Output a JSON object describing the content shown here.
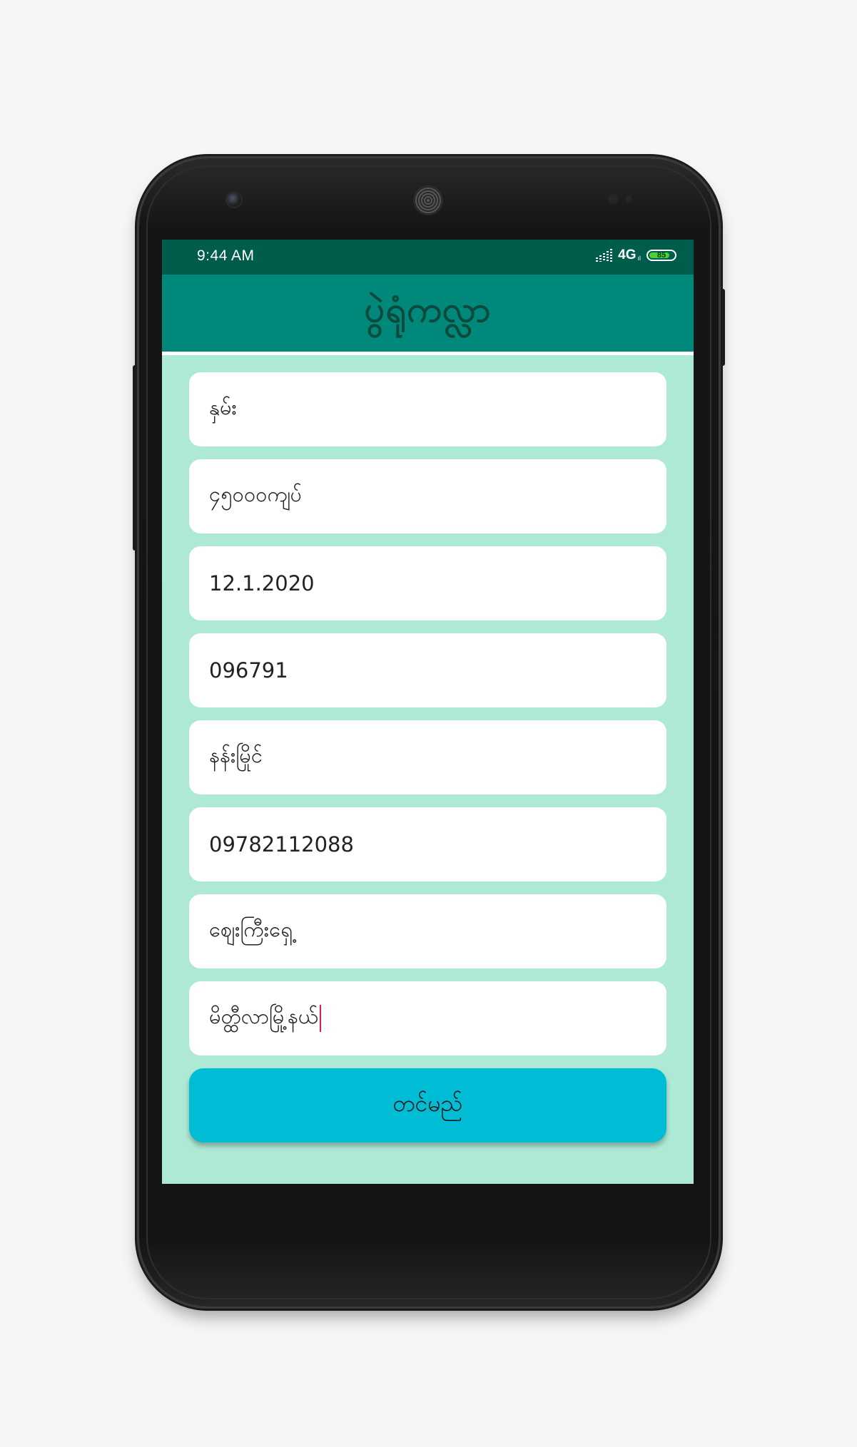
{
  "status_bar": {
    "time": "9:44 AM",
    "network": "4G",
    "network_sub": "ıl",
    "battery": "85",
    "battery_level": 0.85,
    "signal_icon": "signal-bars-icon",
    "battery_icon": "battery-icon"
  },
  "app_bar": {
    "title": "ပွဲရုံကလ္လာ"
  },
  "form": {
    "fields": [
      {
        "value": "နှမ်း"
      },
      {
        "value": "၄၅၀၀၀ကျပ်"
      },
      {
        "value": "12.1.2020"
      },
      {
        "value": "096791"
      },
      {
        "value": "နန်းမြိုင်"
      },
      {
        "value": "09782112088"
      },
      {
        "value": "ဈေးကြီးရှေ့"
      },
      {
        "value": "မိတ္ထီလာမြို့နယ်"
      }
    ],
    "submit_label": "တင်မည်"
  },
  "colors": {
    "status_bar": "#005c4b",
    "app_bar": "#00897b",
    "title_text": "#0b4a3c",
    "form_background": "#aee9d6",
    "field_background": "#ffffff",
    "submit_button": "#00bcd4",
    "caret": "#d81b60",
    "page_background": "#f6f6f6",
    "device_body": "#141414"
  }
}
